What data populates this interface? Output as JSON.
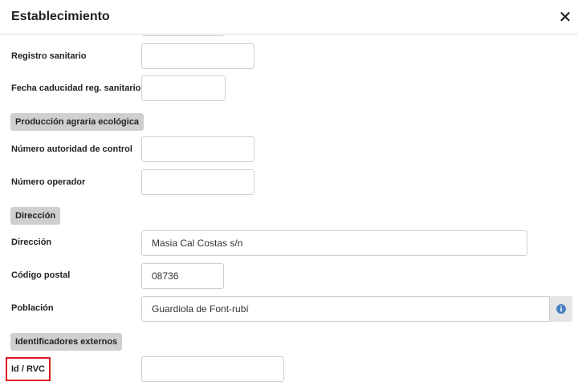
{
  "dialog": {
    "title": "Establecimiento",
    "close_glyph": "✕"
  },
  "fields": {
    "registro_sanitario": {
      "label": "Registro sanitario",
      "value": ""
    },
    "fecha_caducidad": {
      "label": "Fecha caducidad reg. sanitario",
      "value": ""
    },
    "numero_autoridad": {
      "label": "Número autoridad de control",
      "value": ""
    },
    "numero_operador": {
      "label": "Número operador",
      "value": ""
    },
    "direccion": {
      "label": "Dirección",
      "value": "Masia Cal Costas s/n"
    },
    "codigo_postal": {
      "label": "Código postal",
      "value": "08736"
    },
    "poblacion": {
      "label": "Población",
      "value": "Guardiola de Font-rubí"
    },
    "id_rvc": {
      "label": "Id / RVC",
      "value": ""
    }
  },
  "sections": {
    "produccion": "Producción agraria ecológica",
    "direccion": "Dirección",
    "identificadores": "Identificadores externos"
  },
  "icons": {
    "close": "close-icon",
    "info": "info-icon"
  },
  "colors": {
    "accent_info": "#4a7fc1",
    "highlight": "#e0181f",
    "section_bg": "#cfcfcf"
  }
}
